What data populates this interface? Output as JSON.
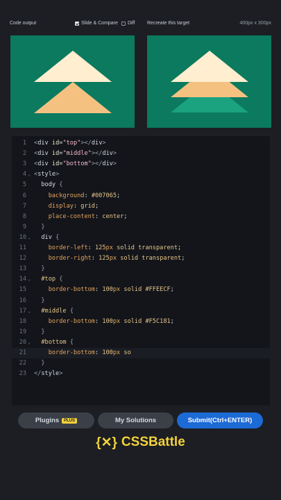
{
  "header": {
    "code_output": "Code output",
    "slide_compare": "Slide & Compare",
    "diff": "Diff",
    "recreate": "Recreate this target",
    "size": "400px x 300px"
  },
  "preview_colors": {
    "bg": "#0B7A5E",
    "top": "#FFEECF",
    "middle": "#F5C181",
    "bottom": "#1BA27E"
  },
  "code_lines": [
    {
      "n": "1",
      "html": "<span class='pun'>&lt;</span><span class='tag'>div</span> <span class='attr'>id</span>=<span class='str'>\"top\"</span><span class='pun'>&gt;&lt;/</span><span class='tag'>div</span><span class='pun'>&gt;</span>"
    },
    {
      "n": "2",
      "html": "<span class='pun'>&lt;</span><span class='tag'>div</span> <span class='attr'>id</span>=<span class='str'>\"middle\"</span><span class='pun'>&gt;&lt;/</span><span class='tag'>div</span><span class='pun'>&gt;</span>"
    },
    {
      "n": "3",
      "html": "<span class='pun'>&lt;</span><span class='tag'>div</span> <span class='attr'>id</span>=<span class='str'>\"bottom\"</span><span class='pun'>&gt;&lt;/</span><span class='tag'>div</span><span class='pun'>&gt;</span>"
    },
    {
      "n": "4",
      "fold": true,
      "html": "<span class='pun'>&lt;</span><span class='tag'>style</span><span class='pun'>&gt;</span>"
    },
    {
      "n": "5",
      "html": "  <span class='tag'>body</span> <span class='pun'>{</span>"
    },
    {
      "n": "6",
      "html": "    <span class='prop'>background</span>: <span class='val'>#007065</span>;"
    },
    {
      "n": "7",
      "html": "    <span class='prop'>display</span>: <span class='val'>grid</span>;"
    },
    {
      "n": "8",
      "html": "    <span class='prop'>place-content</span>: <span class='val'>center</span>;"
    },
    {
      "n": "9",
      "html": "  <span class='pun'>}</span>"
    },
    {
      "n": "10",
      "fold": true,
      "html": "  <span class='tag'>div</span> <span class='pun'>{</span>"
    },
    {
      "n": "11",
      "html": "    <span class='prop'>border-left</span>: <span class='num'>125</span><span class='unit'>px</span> <span class='val'>solid transparent</span>;"
    },
    {
      "n": "12",
      "html": "    <span class='prop'>border-right</span>: <span class='num'>125</span><span class='unit'>px</span> <span class='val'>solid transparent</span>;"
    },
    {
      "n": "13",
      "html": "  <span class='pun'>}</span>"
    },
    {
      "n": "14",
      "fold": true,
      "html": "  <span class='sel'>#top</span> <span class='pun'>{</span>"
    },
    {
      "n": "15",
      "html": "    <span class='prop'>border-bottom</span>: <span class='num'>100</span><span class='unit'>px</span> <span class='val'>solid #FFEECF</span>;"
    },
    {
      "n": "16",
      "html": "  <span class='pun'>}</span>"
    },
    {
      "n": "17",
      "fold": true,
      "html": "  <span class='sel'>#middle</span> <span class='pun'>{</span>"
    },
    {
      "n": "18",
      "html": "    <span class='prop'>border-bottom</span>: <span class='num'>100</span><span class='unit'>px</span> <span class='val'>solid #F5C181</span>;"
    },
    {
      "n": "19",
      "html": "  <span class='pun'>}</span>"
    },
    {
      "n": "20",
      "fold": true,
      "html": "  <span class='sel'>#bottom</span> <span class='pun'>{</span>"
    },
    {
      "n": "21",
      "active": true,
      "html": "    <span class='prop'>border-bottom</span>: <span class='num'>100</span><span class='unit'>px</span> <span class='val'>so</span>"
    },
    {
      "n": "22",
      "html": "  <span class='pun'>}</span>"
    },
    {
      "n": "23",
      "html": "<span class='pun'>&lt;/</span><span class='tag'>style</span><span class='pun'>&gt;</span>"
    }
  ],
  "buttons": {
    "plugins": "Plugins",
    "plus_badge": "PLUS",
    "solutions": "My Solutions",
    "submit": "Submit(Ctrl+ENTER)"
  },
  "logo_text": "CSSBattle",
  "logo_mark": "{✕}"
}
